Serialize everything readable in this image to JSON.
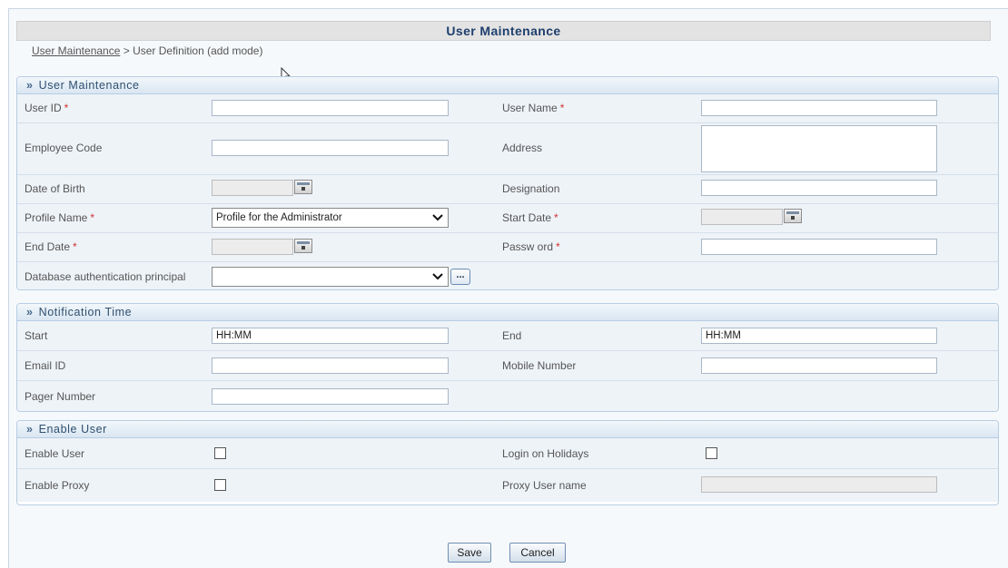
{
  "header": {
    "title": "User Maintenance"
  },
  "breadcrumb": {
    "link": "User Maintenance",
    "separator": " > ",
    "current": "User Definition (add mode)"
  },
  "sections": {
    "user_maintenance": {
      "title": "User Maintenance",
      "user_id_label": "User ID",
      "user_name_label": "User Name",
      "employee_code_label": "Employee Code",
      "address_label": "Address",
      "dob_label": "Date of Birth",
      "designation_label": "Designation",
      "profile_name_label": "Profile Name",
      "profile_name_value": "Profile for the Administrator",
      "start_date_label": "Start Date",
      "end_date_label": "End Date",
      "password_label": "Passw ord",
      "db_auth_label": "Database authentication principal",
      "db_auth_button": "..."
    },
    "notification_time": {
      "title": "Notification Time",
      "start_label": "Start",
      "start_value": "HH:MM",
      "end_label": "End",
      "end_value": "HH:MM",
      "email_label": "Email ID",
      "mobile_label": "Mobile Number",
      "pager_label": "Pager Number"
    },
    "enable_user": {
      "title": "Enable User",
      "enable_user_label": "Enable User",
      "login_holidays_label": "Login on Holidays",
      "enable_proxy_label": "Enable Proxy",
      "proxy_user_label": "Proxy User name"
    }
  },
  "required_marker": "*",
  "section_chevron": "»",
  "buttons": {
    "save": "Save",
    "cancel": "Cancel"
  }
}
